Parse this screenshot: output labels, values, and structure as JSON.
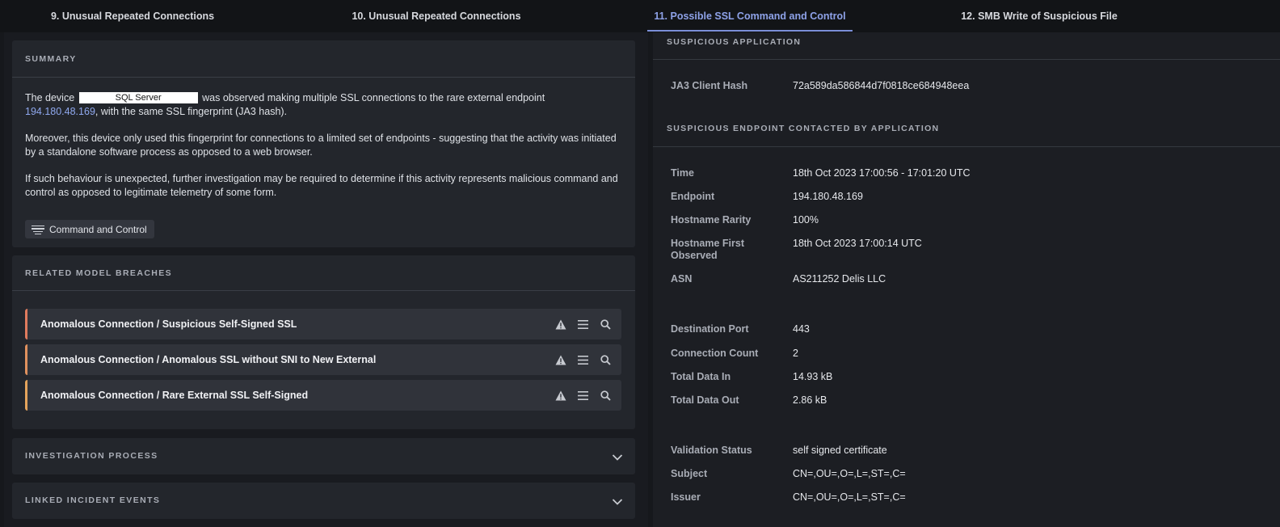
{
  "tabs": [
    {
      "label": "9. Unusual Repeated Connections"
    },
    {
      "label": "10. Unusual Repeated Connections"
    },
    {
      "label": "11. Possible SSL Command and Control"
    },
    {
      "label": "12. SMB Write of Suspicious File"
    }
  ],
  "icons": {
    "prev": "chevron-left-icon",
    "next": "chevron-right-icon",
    "tag": "list-lines-icon",
    "alert": "warning-icon",
    "menu": "menu-icon",
    "search": "search-icon",
    "expand": "chevron-down-icon"
  },
  "colors": {
    "active_tab": "#8ea2e8",
    "link": "#8fa8ee",
    "breach_1": "#e07b5e",
    "breach_2": "#e0915e",
    "breach_3": "#e5a45c"
  },
  "summary": {
    "title": "SUMMARY",
    "p1_pre": "The device",
    "device_name": "SQL Server",
    "p1_mid": "was observed making multiple SSL connections to the rare external endpoint",
    "ip_link": "194.180.48.169",
    "p1_post": ", with the same SSL fingerprint (JA3 hash).",
    "p2": "Moreover, this device only used this fingerprint for connections to a limited set of endpoints - suggesting that the activity was initiated by a standalone software process as opposed to a web browser.",
    "p3": "If such behaviour is unexpected, further investigation may be required to determine if this activity represents malicious command and control as opposed to legitimate telemetry of some form.",
    "tag": "Command and Control"
  },
  "related": {
    "title": "RELATED MODEL BREACHES",
    "items": [
      {
        "label": "Anomalous Connection / Suspicious Self-Signed SSL"
      },
      {
        "label": "Anomalous Connection / Anomalous SSL without SNI to New External"
      },
      {
        "label": "Anomalous Connection / Rare External SSL Self-Signed"
      }
    ]
  },
  "investigation": {
    "title": "INVESTIGATION PROCESS"
  },
  "linked": {
    "title": "LINKED INCIDENT EVENTS"
  },
  "details": {
    "app_title": "SUSPICIOUS APPLICATION",
    "ja3_key": "JA3 Client Hash",
    "ja3_val": "72a589da586844d7f0818ce684948eea",
    "endpoint_title": "SUSPICIOUS ENDPOINT CONTACTED BY APPLICATION",
    "rows": [
      {
        "key": "Time",
        "val": "18th Oct 2023 17:00:56 - 17:01:20 UTC"
      },
      {
        "key": "Endpoint",
        "val": "194.180.48.169"
      },
      {
        "key": "Hostname Rarity",
        "val": "100%"
      },
      {
        "key": "Hostname First Observed",
        "val": "18th Oct 2023 17:00:14 UTC"
      },
      {
        "key": "ASN",
        "val": "AS211252 Delis LLC"
      },
      {
        "key": "Destination Port",
        "val": "443"
      },
      {
        "key": "Connection Count",
        "val": "2"
      },
      {
        "key": "Total Data In",
        "val": "14.93 kB"
      },
      {
        "key": "Total Data Out",
        "val": "2.86 kB"
      },
      {
        "key": "Validation Status",
        "val": "self signed certificate"
      },
      {
        "key": "Subject",
        "val": "CN=,OU=,O=,L=,ST=,C="
      },
      {
        "key": "Issuer",
        "val": "CN=,OU=,O=,L=,ST=,C="
      }
    ]
  }
}
